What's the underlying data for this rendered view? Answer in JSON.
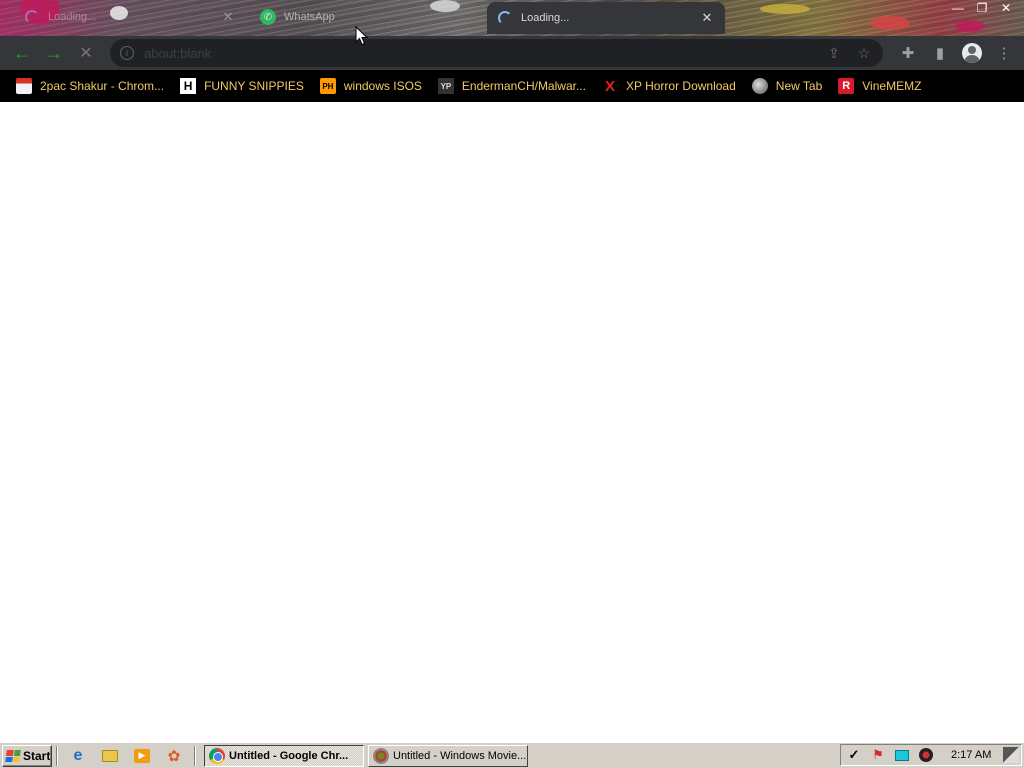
{
  "tabs": [
    {
      "title": "Loading...",
      "icon": "spinner-icon",
      "close": "✕"
    },
    {
      "title": "WhatsApp",
      "icon": "whatsapp-icon",
      "close": ""
    },
    {
      "title": "Loading...",
      "icon": "spinner-icon",
      "close": "✕"
    }
  ],
  "window_controls": {
    "minimize": "—",
    "maximize": "❐",
    "close": "✕"
  },
  "toolbar": {
    "back": "←",
    "forward": "→",
    "stop": "✕",
    "address": "about:blank",
    "share": "⇪",
    "bookmark_star": "☆",
    "extensions": "✚",
    "side_panel": "▮",
    "menu": "⋮"
  },
  "bookmarks": [
    {
      "label": "2pac Shakur - Chrom...",
      "icon": "chrome-web-store-icon"
    },
    {
      "label": "FUNNY SNIPPIES",
      "icon": "h-icon",
      "glyph": "H"
    },
    {
      "label": "windows ISOS",
      "icon": "ph-icon",
      "glyph": "PH"
    },
    {
      "label": "EndermanCH/Malwar...",
      "icon": "yp-icon",
      "glyph": "YP"
    },
    {
      "label": "XP Horror Download",
      "icon": "x-icon",
      "glyph": "X"
    },
    {
      "label": "New Tab",
      "icon": "new-tab-icon",
      "glyph": ""
    },
    {
      "label": "VineMEMZ",
      "icon": "r-icon",
      "glyph": "R"
    }
  ],
  "taskbar": {
    "start": "Start",
    "tasks": [
      {
        "label": "Untitled - Google Chr...",
        "icon": "chrome-icon",
        "active": true
      },
      {
        "label": "Untitled - Windows Movie...",
        "icon": "movie-maker-icon",
        "active": false
      }
    ],
    "clock": "2:17 AM"
  },
  "colors": {
    "toolbar_bg": "#35363a",
    "bookmarks_bg": "#000000",
    "bookmark_text": "#f2c96b",
    "nav_green": "#2f9e38",
    "taskbar_bg": "#d4d0c8"
  }
}
